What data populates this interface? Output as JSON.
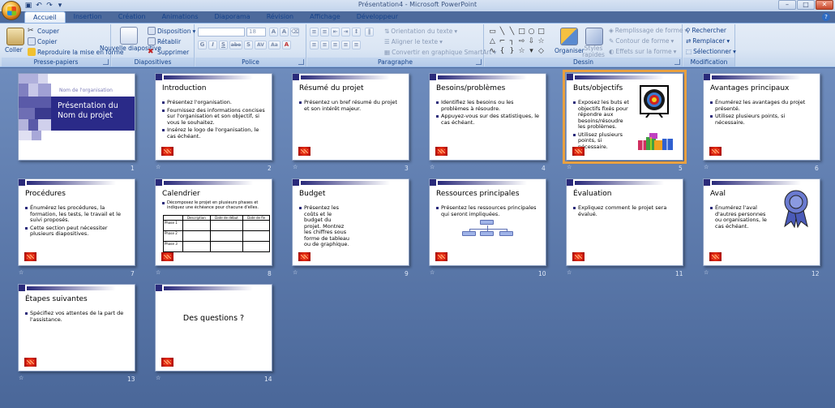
{
  "window": {
    "title": "Présentation4 - Microsoft PowerPoint",
    "controls": [
      "–",
      "□",
      "✕"
    ]
  },
  "qat": [
    "save-icon",
    "undo-icon",
    "redo-icon",
    "qat-dropdown-icon"
  ],
  "tabs": [
    "Accueil",
    "Insertion",
    "Création",
    "Animations",
    "Diaporama",
    "Révision",
    "Affichage",
    "Développeur"
  ],
  "active_tab": "Accueil",
  "ribbon": {
    "clipboard": {
      "label": "Presse-papiers",
      "paste": "Coller",
      "cut": "Couper",
      "copy": "Copier",
      "format_painter": "Reproduire la mise en forme"
    },
    "slides": {
      "label": "Diapositives",
      "new_slide": "Nouvelle diapositive",
      "layout": "Disposition",
      "reset": "Rétablir",
      "delete": "Supprimer"
    },
    "font": {
      "label": "Police",
      "size": "18",
      "bold": "G",
      "italic": "I",
      "underline": "S",
      "strike": "abe",
      "shadow": "S",
      "spacing": "AV",
      "case": "Aa"
    },
    "paragraph": {
      "label": "Paragraphe",
      "text_direction": "Orientation du texte",
      "align_text": "Aligner le texte",
      "smartart": "Convertir en graphique SmartArt"
    },
    "drawing": {
      "label": "Dessin",
      "arrange": "Organiser",
      "quick_styles": "Styles rapides",
      "fill": "Remplissage de forme",
      "outline": "Contour de forme",
      "effects": "Effets sur la forme"
    },
    "editing": {
      "label": "Modification",
      "find": "Rechercher",
      "replace": "Remplacer",
      "select": "Sélectionner"
    }
  },
  "slides": [
    {
      "num": "1",
      "layout": "title",
      "org": "Nom de l'organisation",
      "title_l1": "Présentation du",
      "title_l2": "Nom du projet"
    },
    {
      "num": "2",
      "title": "Introduction",
      "bullets": [
        "Présentez l'organisation.",
        "Fournissez des informations concises sur l'organisation et son objectif, si vous le souhaitez.",
        "Insérez le logo de l'organisation, le cas échéant."
      ]
    },
    {
      "num": "3",
      "title": "Résumé du projet",
      "bullets": [
        "Présentez un bref résumé du projet et son intérêt majeur."
      ]
    },
    {
      "num": "4",
      "title": "Besoins/problèmes",
      "bullets": [
        "Identifiez les besoins ou les problèmes à résoudre.",
        "Appuyez-vous sur des statistiques, le cas échéant."
      ]
    },
    {
      "num": "5",
      "title": "Buts/objectifs",
      "bullets": [
        "Exposez les buts et objectifs fixés pour répondre aux besoins/résoudre les problèmes.",
        "Utilisez plusieurs points, si nécessaire."
      ]
    },
    {
      "num": "6",
      "title": "Avantages principaux",
      "bullets": [
        "Énumérez les avantages du projet présenté.",
        "Utilisez plusieurs points, si nécessaire."
      ]
    },
    {
      "num": "7",
      "title": "Procédures",
      "bullets": [
        "Énumérez les procédures, la formation, les tests, le travail et le suivi proposés.",
        "Cette section peut nécessiter plusieurs diapositives."
      ]
    },
    {
      "num": "8",
      "title": "Calendrier",
      "bullets": [
        "Décomposez le projet en plusieurs phases et indiquez une échéance pour chacune d'elles."
      ],
      "table": {
        "headers": [
          "",
          "Description",
          "Date de début",
          "Date de fin"
        ],
        "rows": [
          "Phase 1",
          "Phase 2",
          "Phase 3"
        ]
      }
    },
    {
      "num": "9",
      "title": "Budget",
      "bullets": [
        "Présentez les coûts et le budget du projet. Montrez les chiffres sous forme de tableau ou de graphique."
      ]
    },
    {
      "num": "10",
      "title": "Ressources principales",
      "bullets": [
        "Présentez les ressources principales qui seront impliquées."
      ]
    },
    {
      "num": "11",
      "title": "Évaluation",
      "bullets": [
        "Expliquez comment le projet sera évalué."
      ]
    },
    {
      "num": "12",
      "title": "Aval",
      "bullets": [
        "Énumérez l'aval d'autres personnes ou organisations, le cas échéant."
      ]
    },
    {
      "num": "13",
      "title": "Étapes suivantes",
      "bullets": [
        "Spécifiez vos attentes de la part de l'assistance."
      ]
    },
    {
      "num": "14",
      "title": "",
      "center": "Des questions ?"
    }
  ],
  "selected_slide": "5",
  "colors": {
    "sorter_bg": "#5a78aa",
    "slide_accent": "#2a2a7a",
    "selection": "#e8a040",
    "ribbon": "#dbe6f4"
  }
}
